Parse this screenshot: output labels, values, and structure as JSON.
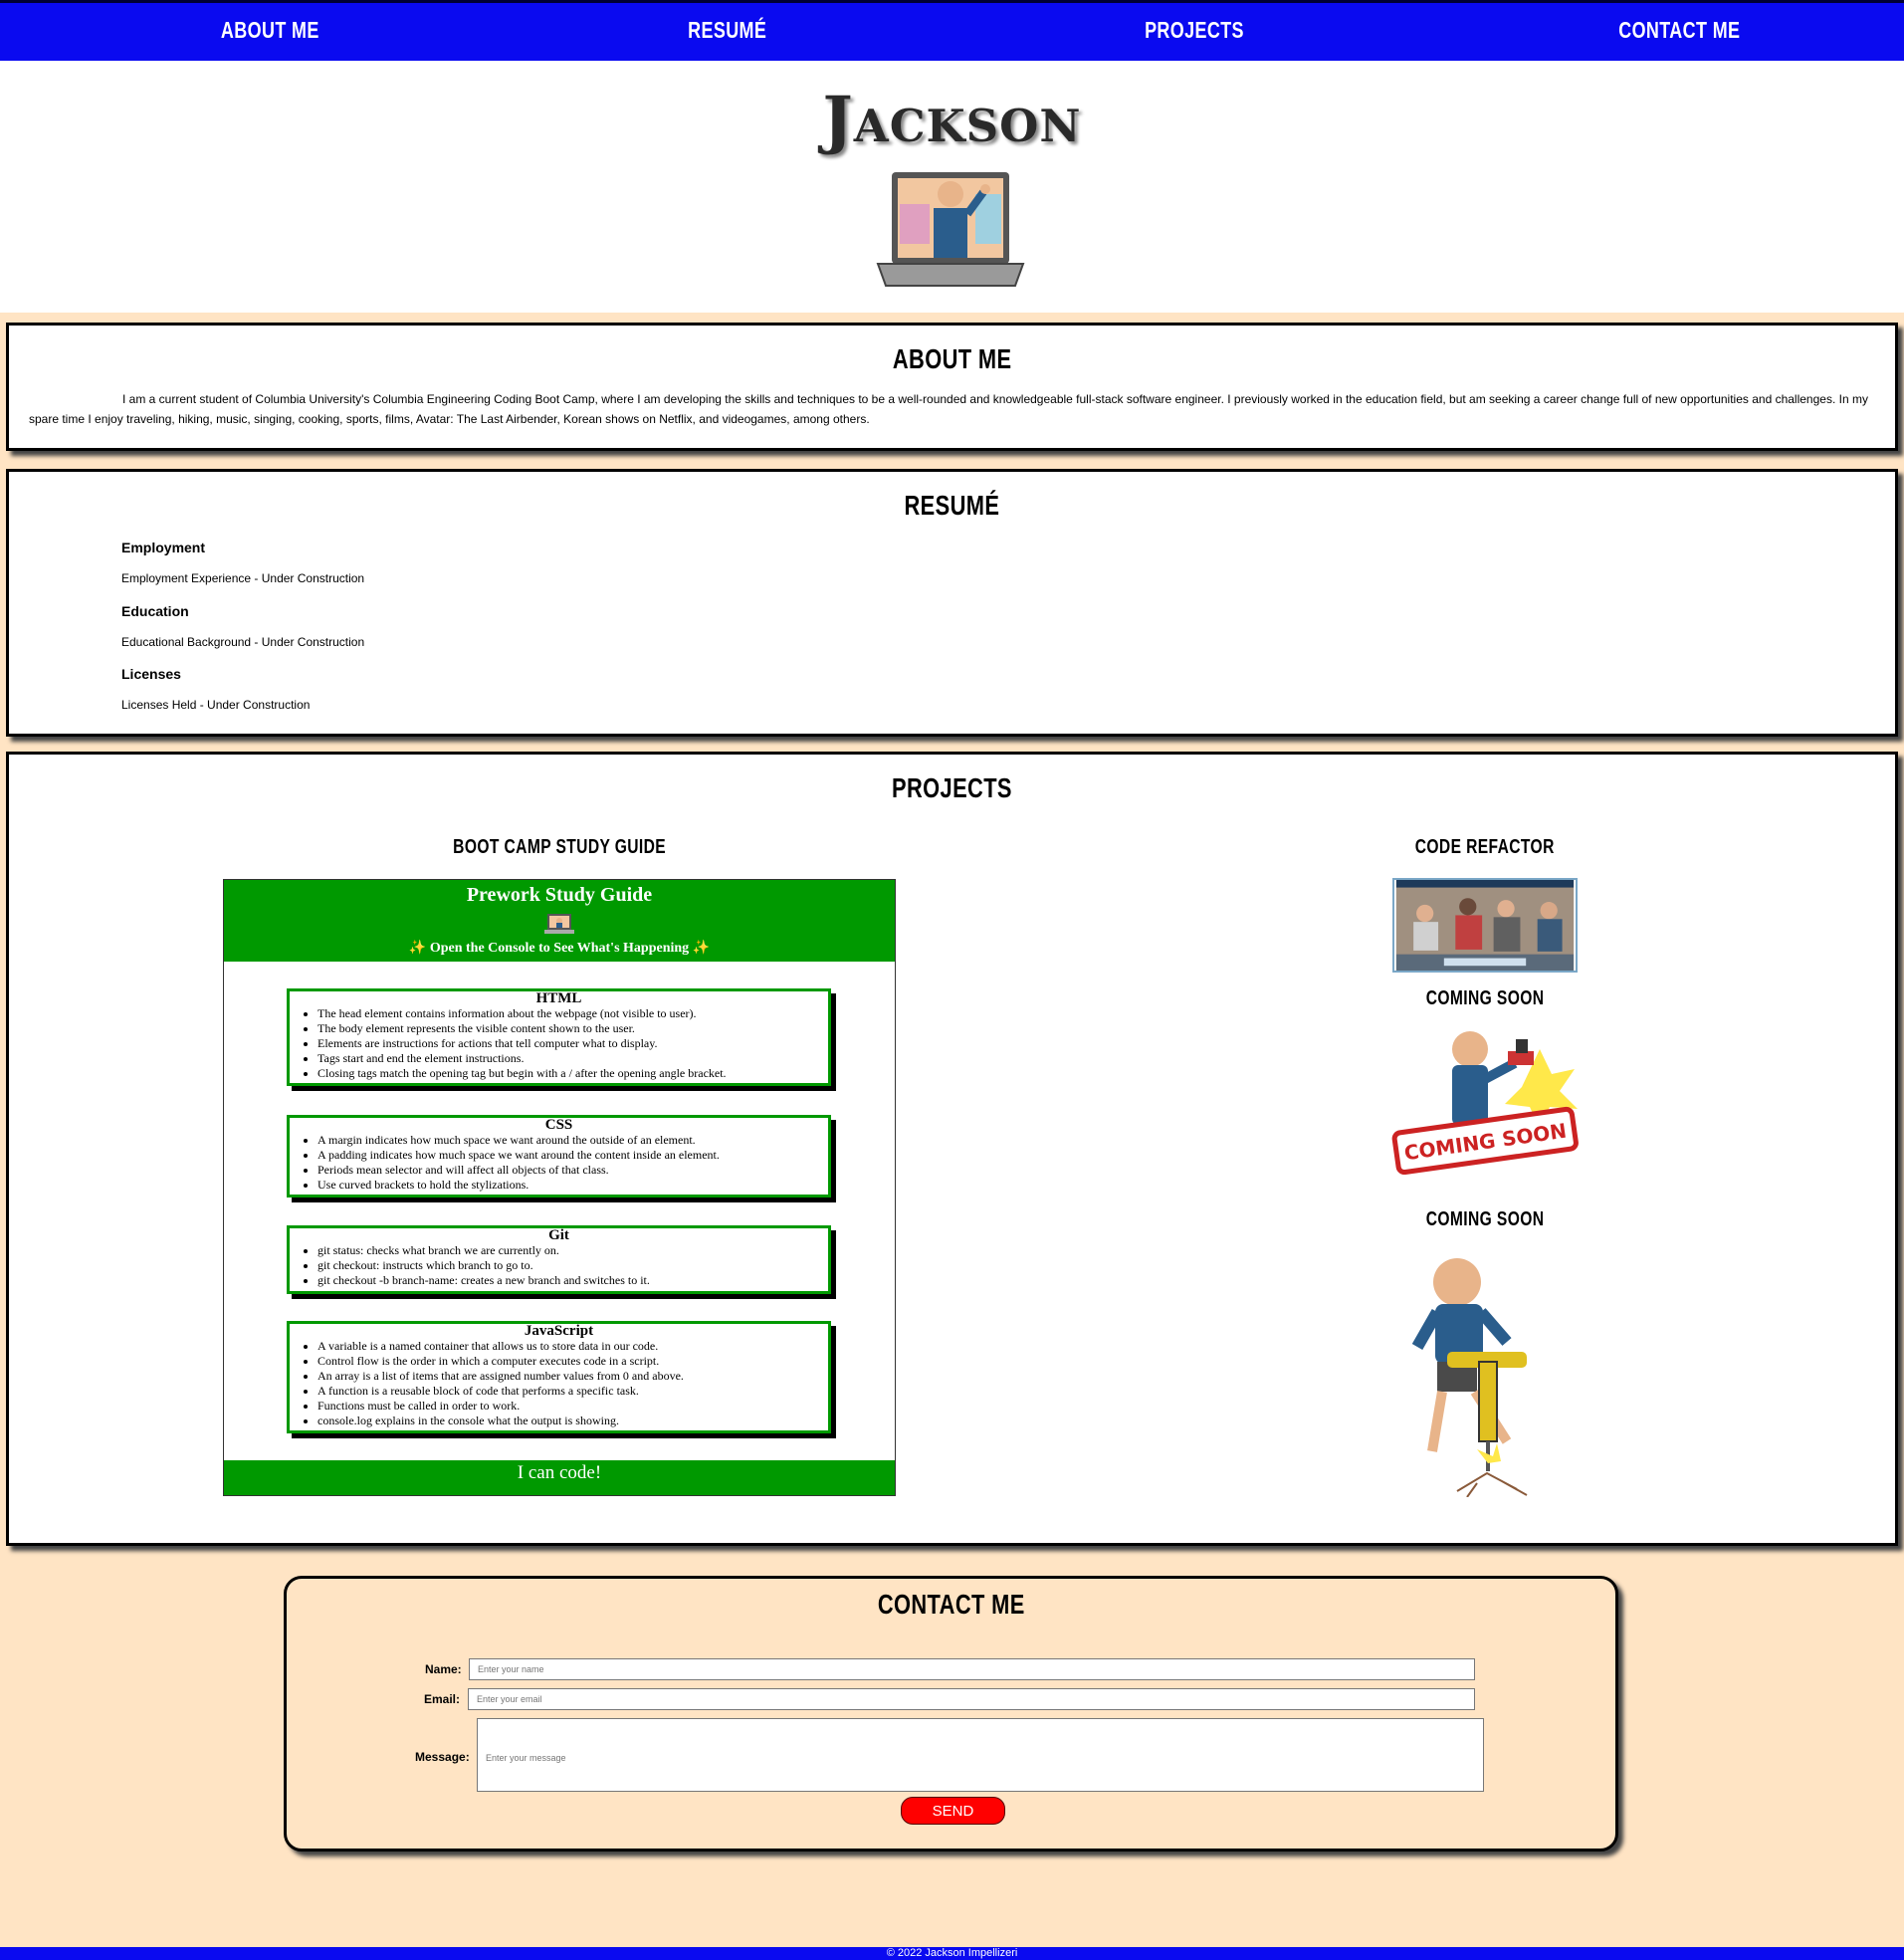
{
  "nav": {
    "about": "About Me",
    "resume": "Resumé",
    "projects": "Projects",
    "contact": "Contact Me"
  },
  "header": {
    "name": "Jackson"
  },
  "about": {
    "heading": "About Me",
    "body": "I am a current student of Columbia University's Columbia Engineering Coding Boot Camp, where I am developing the skills and techniques to be a well-rounded and knowledgeable full-stack software engineer. I previously worked in the education field, but am seeking a career change full of new opportunities and challenges. In my spare time I enjoy traveling, hiking, music, singing, cooking, sports, films, Avatar: The Last Airbender, Korean shows on Netflix, and videogames, among others."
  },
  "resume": {
    "heading": "Resumé",
    "items": [
      {
        "title": "Employment",
        "text": "Employment Experience - Under Construction"
      },
      {
        "title": "Education",
        "text": "Educational Background - Under Construction"
      },
      {
        "title": "Licenses",
        "text": "Licenses Held - Under Construction"
      }
    ]
  },
  "projects": {
    "heading": "Projects",
    "items": [
      {
        "title": "Boot Camp Study Guide"
      },
      {
        "title": "Code Refactor"
      },
      {
        "title": "Coming Soon",
        "badge": "COMING SOON"
      },
      {
        "title": "Coming Soon"
      }
    ],
    "guide": {
      "title": "Prework Study Guide",
      "subtitle": "Open the Console to See What's Happening",
      "footer": "I can code!",
      "cards": [
        {
          "title": "HTML",
          "items": [
            "The head element contains information about the webpage (not visible to user).",
            "The body element represents the visible content shown to the user.",
            "Elements are instructions for actions that tell computer what to display.",
            "Tags start and end the element instructions.",
            "Closing tags match the opening tag but begin with a / after the opening angle bracket."
          ]
        },
        {
          "title": "CSS",
          "items": [
            "A margin indicates how much space we want around the outside of an element.",
            "A padding indicates how much space we want around the content inside an element.",
            "Periods mean selector and will affect all objects of that class.",
            "Use curved brackets to hold the stylizations."
          ]
        },
        {
          "title": "Git",
          "items": [
            "git status: checks what branch we are currently on.",
            "git checkout: instructs which branch to go to.",
            "git checkout -b branch-name: creates a new branch and switches to it."
          ]
        },
        {
          "title": "JavaScript",
          "items": [
            "A variable is a named container that allows us to store data in our code.",
            "Control flow is the order in which a computer executes code in a script.",
            "An array is a list of items that are assigned number values from 0 and above.",
            "A function is a reusable block of code that performs a specific task.",
            "Functions must be called in order to work.",
            "console.log explains in the console what the output is showing."
          ]
        }
      ]
    }
  },
  "contact": {
    "heading": "Contact Me",
    "name_label": "Name:",
    "name_placeholder": "Enter your name",
    "email_label": "Email:",
    "email_placeholder": "Enter your email",
    "message_label": "Message:",
    "message_placeholder": "Enter your message",
    "send_label": "SEND"
  },
  "footer": {
    "text": "© 2022 Jackson Impellizeri"
  },
  "colors": {
    "nav": "#0a0af0",
    "page_bg": "#ffe4c4",
    "guide_green": "#009900",
    "send_red": "#ff0000"
  }
}
